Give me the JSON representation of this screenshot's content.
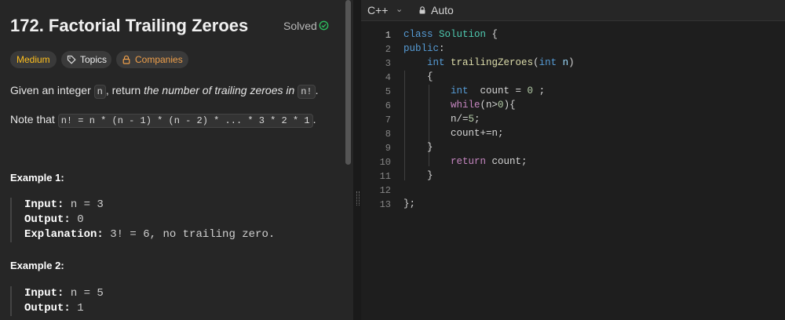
{
  "problem": {
    "title": "172. Factorial Trailing Zeroes",
    "solved_label": "Solved",
    "tags": {
      "difficulty": "Medium",
      "topics": "Topics",
      "companies": "Companies"
    },
    "desc_p1": {
      "pre": "Given an integer ",
      "code": "n",
      "mid": ", return ",
      "em": "the number of trailing zeroes in ",
      "code2": "n!",
      "end": "."
    },
    "desc_p2": {
      "pre": "Note that ",
      "code": "n! = n * (n - 1) * (n - 2) * ... * 3 * 2 * 1",
      "end": "."
    },
    "examples": [
      {
        "header": "Example 1:",
        "input_label": "Input:",
        "input": " n = 3",
        "output_label": "Output:",
        "output": " 0",
        "explanation_label": "Explanation:",
        "explanation": " 3! = 6, no trailing zero."
      },
      {
        "header": "Example 2:",
        "input_label": "Input:",
        "input": " n = 5",
        "output_label": "Output:",
        "output": " 1"
      }
    ]
  },
  "editor": {
    "language": "C++",
    "mode": "Auto",
    "line_numbers": [
      "1",
      "2",
      "3",
      "4",
      "5",
      "6",
      "7",
      "8",
      "9",
      "10",
      "11",
      "12",
      "13"
    ]
  },
  "icons": {
    "solved": "check-circle-icon",
    "topics": "tag-icon",
    "companies": "lock-icon",
    "mode": "lock-icon"
  },
  "colors": {
    "medium": "#ffc01e",
    "solved": "#2cbb5d",
    "companies": "#f0a04b",
    "keyword": "#569cd6",
    "type": "#4ec9b0",
    "function": "#dcdcaa",
    "number": "#b5cea8",
    "control": "#c586c0"
  }
}
